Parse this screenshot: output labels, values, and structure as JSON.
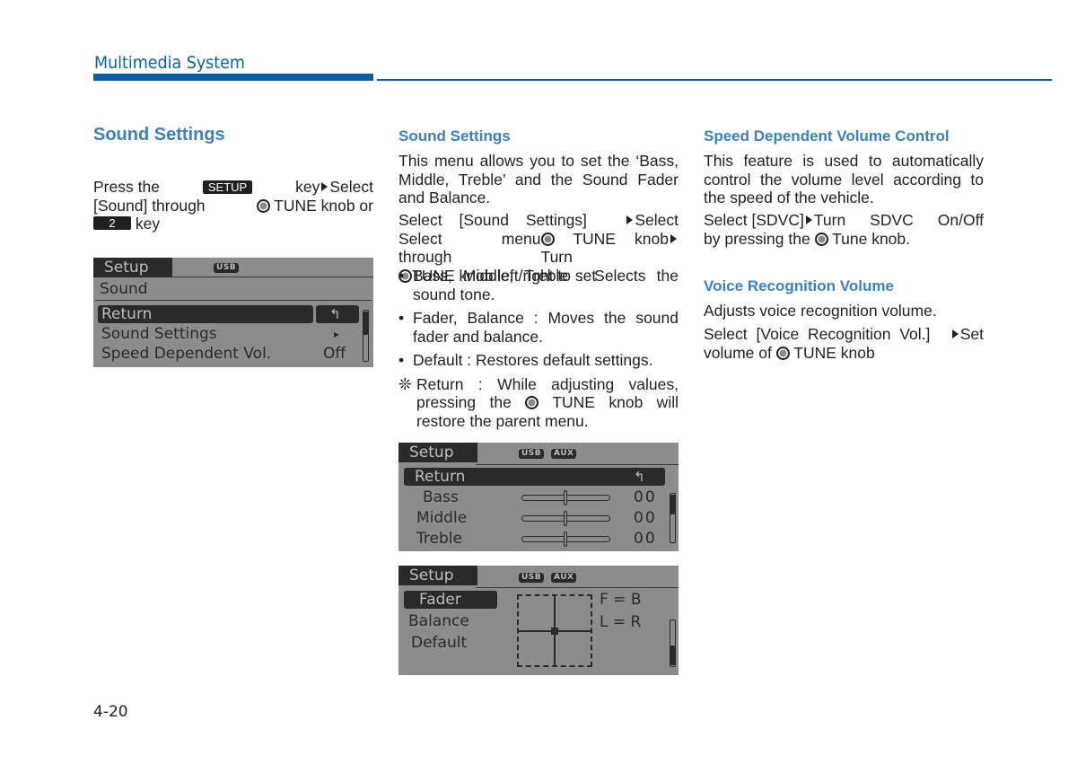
{
  "header": {
    "section_title": "Multimedia System",
    "accent_color": "#0d5fa3"
  },
  "column1": {
    "heading": "Sound Settings",
    "instruction": {
      "press_the": "Press the",
      "setup_key": "SETUP",
      "key_select": "key",
      "select": "Select",
      "sound_through": "[Sound] through",
      "tune_knob_or": "TUNE knob or",
      "num_key": "2",
      "key": "key"
    },
    "screen": {
      "tab": "Setup",
      "badges": [
        "USB"
      ],
      "subtitle": "Sound",
      "rows": [
        {
          "label": "Return",
          "value": "↰",
          "selected": true
        },
        {
          "label": "Sound Settings",
          "value": "▸",
          "selected": false
        },
        {
          "label": "Speed Dependent Vol.",
          "value": "Off",
          "selected": false
        }
      ]
    }
  },
  "column2": {
    "heading": "Sound Settings",
    "intro": "This menu allows you to set the ‘Bass, Middle, Treble’ and the Sound Fader and Balance.",
    "instruction": {
      "part1": "Select [Sound Settings]",
      "part2": "Select menu through",
      "part3": "TUNE knob",
      "part4": "Turn",
      "part5": "TUNE knob left/right to set"
    },
    "bullets": [
      "Bass, Middle, Treble : Selects the sound tone.",
      "Fader, Balance : Moves the sound fader and balance.",
      "Default : Restores default settings."
    ],
    "note": {
      "symbol": "❊",
      "part1": "Return : While adjusting values, pressing the",
      "part2": "TUNE knob will restore the parent menu."
    },
    "screen_tone": {
      "tab": "Setup",
      "badges": [
        "USB",
        "AUX"
      ],
      "return_label": "Return",
      "return_icon": "↰",
      "rows": [
        {
          "label": "Bass",
          "value": "00",
          "level": 0.5
        },
        {
          "label": "Middle",
          "value": "00",
          "level": 0.5
        },
        {
          "label": "Treble",
          "value": "00",
          "level": 0.5
        }
      ]
    },
    "screen_fader": {
      "tab": "Setup",
      "badges": [
        "USB",
        "AUX"
      ],
      "items": [
        {
          "label": "Fader",
          "selected": true
        },
        {
          "label": "Balance",
          "selected": false
        },
        {
          "label": "Default",
          "selected": false
        }
      ],
      "fader_readout": "F = B",
      "balance_readout": "L = R"
    }
  },
  "column3": {
    "sdvc": {
      "heading": "Speed Dependent Volume Control",
      "description": "This feature is used to automatically control the volume level according to the speed of the vehicle.",
      "instr_part1": "Select [SDVC]",
      "instr_part2": "Turn SDVC On/Off by pressing the",
      "instr_part3": "Tune knob."
    },
    "voice": {
      "heading": "Voice Recognition Volume",
      "description": "Adjusts voice recognition volume.",
      "instr_part1": "Select [Voice Recognition Vol.]",
      "instr_part2": "Set volume of",
      "instr_part3": "TUNE knob"
    }
  },
  "footer": {
    "page_number": "4-20"
  }
}
